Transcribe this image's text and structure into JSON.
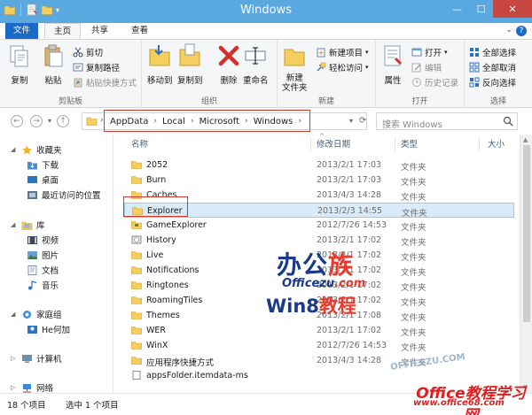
{
  "window": {
    "title": "Windows"
  },
  "tabs": {
    "file": "文件",
    "home": "主页",
    "share": "共享",
    "view": "查看"
  },
  "ribbon": {
    "clipboard": {
      "label": "剪贴板",
      "copy": "复制",
      "paste": "粘贴",
      "cut": "剪切",
      "copy_path": "复制路径",
      "paste_shortcut": "粘贴快捷方式"
    },
    "organize": {
      "label": "组织",
      "move_to": "移动到",
      "copy_to": "复制到",
      "delete": "删除",
      "rename": "重命名"
    },
    "new": {
      "label": "新建",
      "new_folder": "新建\n文件夹",
      "new_item": "新建项目",
      "easy_access": "轻松访问"
    },
    "open": {
      "label": "打开",
      "properties": "属性",
      "open": "打开",
      "edit": "编辑",
      "history": "历史记录"
    },
    "select": {
      "label": "选择",
      "select_all": "全部选择",
      "select_none": "全部取消",
      "invert": "反向选择"
    }
  },
  "address": {
    "crumbs": [
      "AppData",
      "Local",
      "Microsoft",
      "Windows"
    ],
    "search_placeholder": "搜索 Windows"
  },
  "nav": {
    "favorites": "收藏夹",
    "fav_items": [
      "下载",
      "桌面",
      "最近访问的位置"
    ],
    "libraries": "库",
    "lib_items": [
      "视频",
      "图片",
      "文档",
      "音乐"
    ],
    "homegroup": "家庭组",
    "homegroup_user": "He何加",
    "computer": "计算机",
    "network": "网络"
  },
  "columns": {
    "name": "名称",
    "modified": "修改日期",
    "type": "类型",
    "size": "大小"
  },
  "files": [
    {
      "name": "2052",
      "date": "2013/2/1 17:03",
      "type": "文件夹"
    },
    {
      "name": "Burn",
      "date": "2013/2/1 17:03",
      "type": "文件夹"
    },
    {
      "name": "Caches",
      "date": "2013/4/3 14:28",
      "type": "文件夹"
    },
    {
      "name": "Explorer",
      "date": "2013/2/3 14:55",
      "type": "文件夹"
    },
    {
      "name": "GameExplorer",
      "date": "2012/7/26 14:53",
      "type": "文件夹"
    },
    {
      "name": "History",
      "date": "2013/2/1 17:02",
      "type": "文件夹"
    },
    {
      "name": "Live",
      "date": "2013/2/1 17:02",
      "type": "文件夹"
    },
    {
      "name": "Notifications",
      "date": "2013/2/1 17:02",
      "type": "文件夹"
    },
    {
      "name": "Ringtones",
      "date": "2013/2/1 17:02",
      "type": "文件夹"
    },
    {
      "name": "RoamingTiles",
      "date": "2013/2/1 17:02",
      "type": "文件夹"
    },
    {
      "name": "Themes",
      "date": "2013/2/1 17:08",
      "type": "文件夹"
    },
    {
      "name": "WER",
      "date": "2013/2/1 17:02",
      "type": "文件夹"
    },
    {
      "name": "WinX",
      "date": "2012/7/26 14:53",
      "type": "文件夹"
    },
    {
      "name": "应用程序快捷方式",
      "date": "2013/4/3 14:28",
      "type": "文件夹"
    },
    {
      "name": "appsFolder.itemdata-ms",
      "date": "",
      "type": ""
    }
  ],
  "status": {
    "count": "18 个项目",
    "selected": "选中 1 个项目"
  },
  "watermark": {
    "line1a": "办公",
    "line1b": "族",
    "line2a": "Officezu",
    "line2b": ".com",
    "line3a": "Win8",
    "line3b": "教程",
    "line4": "Office教程学习网",
    "line5": "www.office68.com",
    "line6": "OFFICEZU.COM"
  },
  "colors": {
    "titlebar": "#59a8df",
    "file_tab": "#1b6ac6",
    "selection": "#d9ebf9",
    "highlight_box": "#d23a2e"
  }
}
